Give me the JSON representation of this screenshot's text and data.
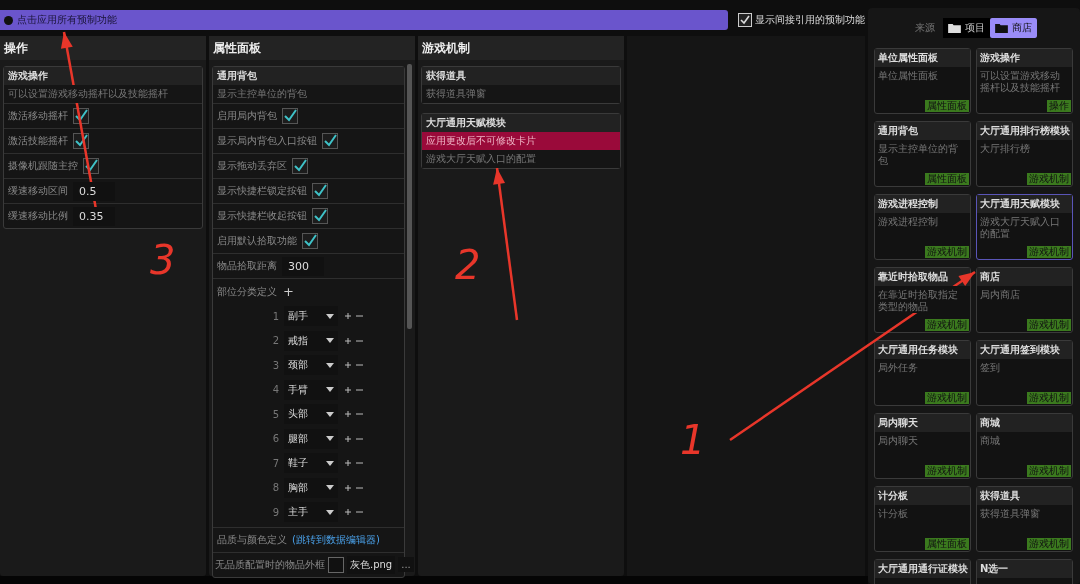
{
  "apply_all_button": {
    "label": "点击应用所有预制功能"
  },
  "show_indirect": {
    "label": "显示间接引用的预制功能",
    "checked": true
  },
  "columns": [
    {
      "title": "操作",
      "modules": [
        {
          "title": "游戏操作",
          "rows": [
            {
              "kind": "text",
              "text": "可以设置游戏移动摇杆以及技能摇杆",
              "highlighted": false
            },
            {
              "kind": "checkbox",
              "label": "激活移动摇杆",
              "checked": true
            },
            {
              "kind": "checkbox",
              "label": "激活技能摇杆",
              "checked": true
            },
            {
              "kind": "checkbox",
              "label": "摄像机跟随主控",
              "checked": true
            },
            {
              "kind": "number",
              "label": "缓速移动区间",
              "value": "0.5"
            },
            {
              "kind": "number",
              "label": "缓速移动比例",
              "value": "0.35"
            }
          ]
        }
      ]
    },
    {
      "title": "属性面板",
      "modules": [
        {
          "title": "通用背包",
          "rows": [
            {
              "kind": "text",
              "text": "显示主控单位的背包",
              "highlighted": false
            },
            {
              "kind": "checkbox",
              "label": "启用局内背包",
              "checked": true
            },
            {
              "kind": "checkbox",
              "label": "显示局内背包入口按钮",
              "checked": true
            },
            {
              "kind": "checkbox",
              "label": "显示拖动丢弃区",
              "checked": true
            },
            {
              "kind": "checkbox",
              "label": "显示快捷栏锁定按钮",
              "checked": true
            },
            {
              "kind": "checkbox",
              "label": "显示快捷栏收起按钮",
              "checked": true
            },
            {
              "kind": "checkbox",
              "label": "启用默认拾取功能",
              "checked": true
            },
            {
              "kind": "number",
              "label": "物品拾取距离",
              "value": "300"
            },
            {
              "kind": "list",
              "label": "部位分类定义",
              "add": "+",
              "items": [
                {
                  "index": "1",
                  "value": "副手"
                },
                {
                  "index": "2",
                  "value": "戒指"
                },
                {
                  "index": "3",
                  "value": "颈部"
                },
                {
                  "index": "4",
                  "value": "手臂"
                },
                {
                  "index": "5",
                  "value": "头部"
                },
                {
                  "index": "6",
                  "value": "腿部"
                },
                {
                  "index": "7",
                  "value": "鞋子"
                },
                {
                  "index": "8",
                  "value": "胸部"
                },
                {
                  "index": "9",
                  "value": "主手"
                }
              ]
            },
            {
              "kind": "link",
              "label": "品质与颜色定义",
              "link": "(跳转到数据编辑器)"
            },
            {
              "kind": "file",
              "label": "无品质配置时的物品外框",
              "value": "灰色.png",
              "browse": "..."
            }
          ]
        }
      ]
    },
    {
      "title": "游戏机制",
      "modules": [
        {
          "title": "获得道具",
          "rows": [
            {
              "kind": "text",
              "text": "获得道具弹窗",
              "highlighted": false
            }
          ]
        },
        {
          "title": "大厅通用天赋模块",
          "rows": [
            {
              "kind": "text",
              "text": "应用更改后不可修改卡片",
              "highlighted": true
            },
            {
              "kind": "text",
              "text": "游戏大厅天赋入口的配置",
              "highlighted": false
            }
          ]
        }
      ]
    }
  ],
  "source": {
    "label": "来源",
    "tabs": [
      {
        "label": "项目",
        "selected": false
      },
      {
        "label": "商店",
        "selected": true
      }
    ]
  },
  "cards": [
    {
      "title": "单位属性面板",
      "description": "单位属性面板",
      "tag": "属性面板",
      "selected": false
    },
    {
      "title": "游戏操作",
      "description": "可以设置游戏移动摇杆以及技能摇杆",
      "tag": "操作",
      "selected": false
    },
    {
      "title": "通用背包",
      "description": "显示主控单位的背包",
      "tag": "属性面板",
      "selected": false
    },
    {
      "title": "大厅通用排行榜模块",
      "description": "大厅排行榜",
      "tag": "游戏机制",
      "selected": false
    },
    {
      "title": "游戏进程控制",
      "description": "游戏进程控制",
      "tag": "游戏机制",
      "selected": false
    },
    {
      "title": "大厅通用天赋模块",
      "description": "游戏大厅天赋入口的配置",
      "tag": "游戏机制",
      "selected": true
    },
    {
      "title": "靠近时拾取物品",
      "description": "在靠近时拾取指定类型的物品",
      "tag": "游戏机制",
      "selected": false
    },
    {
      "title": "商店",
      "description": "局内商店",
      "tag": "游戏机制",
      "selected": false
    },
    {
      "title": "大厅通用任务模块",
      "description": "局外任务",
      "tag": "游戏机制",
      "selected": false
    },
    {
      "title": "大厅通用签到模块",
      "description": "签到",
      "tag": "游戏机制",
      "selected": false
    },
    {
      "title": "局内聊天",
      "description": "局内聊天",
      "tag": "游戏机制",
      "selected": false
    },
    {
      "title": "商城",
      "description": "商城",
      "tag": "游戏机制",
      "selected": false
    },
    {
      "title": "计分板",
      "description": "计分板",
      "tag": "属性面板",
      "selected": false
    },
    {
      "title": "获得道具",
      "description": "获得道具弹窗",
      "tag": "游戏机制",
      "selected": false
    },
    {
      "title": "大厅通用通行证模块",
      "selected": false
    },
    {
      "title": "N选一",
      "selected": false
    }
  ],
  "annotations": [
    {
      "label": "3"
    },
    {
      "label": "2"
    },
    {
      "label": "1"
    }
  ]
}
